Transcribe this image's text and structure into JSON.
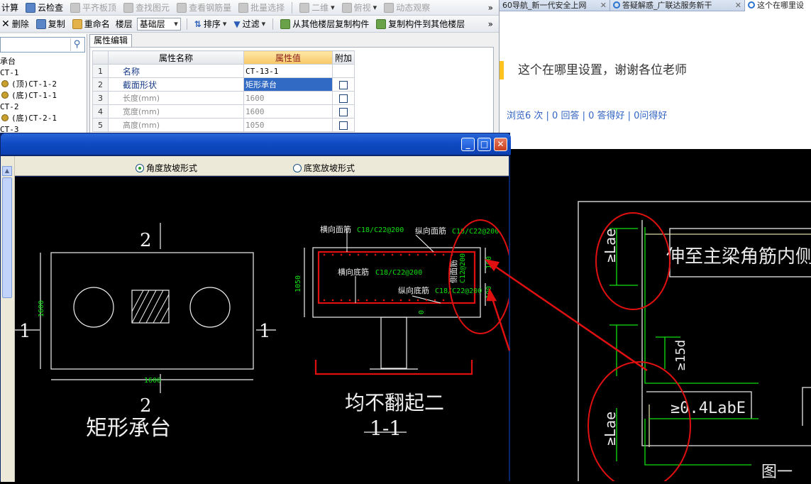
{
  "toolbar1": {
    "items": [
      {
        "label": "计算",
        "disabled": false
      },
      {
        "label": "云检查",
        "disabled": false
      },
      {
        "label": "平齐板顶",
        "disabled": true
      },
      {
        "label": "查找图元",
        "disabled": true
      },
      {
        "label": "查看钢筋量",
        "disabled": true
      },
      {
        "label": "批量选择",
        "disabled": true
      },
      {
        "label": "二维",
        "disabled": true
      },
      {
        "label": "俯视",
        "disabled": true
      },
      {
        "label": "动态观察",
        "disabled": true
      }
    ],
    "more": "»"
  },
  "toolbar2": {
    "delete": "删除",
    "copy": "复制",
    "rename": "重命名",
    "floor_label": "楼层",
    "floor_value": "基础层",
    "sort": "排序",
    "filter": "过滤",
    "copy_from": "从其他楼层复制构件",
    "copy_to": "复制构件到其他楼层",
    "more": "»"
  },
  "tree": {
    "items": [
      "承台",
      "CT-1",
      "(顶)CT-1-2",
      "(底)CT-1-1",
      "CT-2",
      "(底)CT-2-1",
      "CT-3"
    ]
  },
  "props": {
    "tab": "属性编辑",
    "headers": {
      "name": "属性名称",
      "value": "属性值",
      "extra": "附加"
    },
    "rows": [
      {
        "n": "1",
        "name": "名称",
        "value": "CT-13-1",
        "check": false
      },
      {
        "n": "2",
        "name": "截面形状",
        "value": "矩形承台",
        "check": true
      },
      {
        "n": "3",
        "name": "长度(mm)",
        "value": "1600",
        "check": true
      },
      {
        "n": "4",
        "name": "宽度(mm)",
        "value": "1600",
        "check": true
      },
      {
        "n": "5",
        "name": "高度(mm)",
        "value": "1050",
        "check": true
      }
    ]
  },
  "browser": {
    "tabs": [
      "60导航_新一代安全上网",
      "答疑解惑_广联达服务新干",
      "这个在哪里设"
    ],
    "question": "这个在哪里设置，谢谢各位老师",
    "stats": "浏览6 次 | 0 回答 | 0 答得好 | 0问得好"
  },
  "dialog": {
    "options": [
      {
        "label": "角度放坡形式",
        "selected": true
      },
      {
        "label": "底宽放坡形式",
        "selected": false
      }
    ],
    "plan": {
      "section_top": "2",
      "section_bottom": "2",
      "section_left": "1",
      "section_right": "1",
      "dim_height": "1600",
      "dim_width": "1600",
      "caption": "矩形承台"
    },
    "section": {
      "top_bar_label": "横向面筋",
      "top_bar_spec": "C18/C22@200",
      "long_top_label": "纵向面筋",
      "long_top_spec": "C18/C22@200",
      "bot_bar_label": "横向底筋",
      "bot_bar_spec": "C18/C22@200",
      "long_bot_label": "纵向底筋",
      "long_bot_spec": "C18/C22@200",
      "side_label": "侧面筋",
      "side_spec": "C12@200",
      "height": "1050",
      "d1": "100",
      "d2": "100",
      "d3": "0",
      "caption": "均不翻起二",
      "section_name": "1-1"
    }
  },
  "detail": {
    "text_top": "伸至主梁角筋内侧,并向下",
    "lae_top": "≥Lae",
    "fifteen_d": "≥15d",
    "lae_bottom": "≥Lae",
    "labe": "≥0.4LabE",
    "corner": "图一"
  },
  "colors": {
    "annotation_red": "#e01010",
    "cad_green": "#10e010",
    "highlight_blue": "#316ac5"
  }
}
